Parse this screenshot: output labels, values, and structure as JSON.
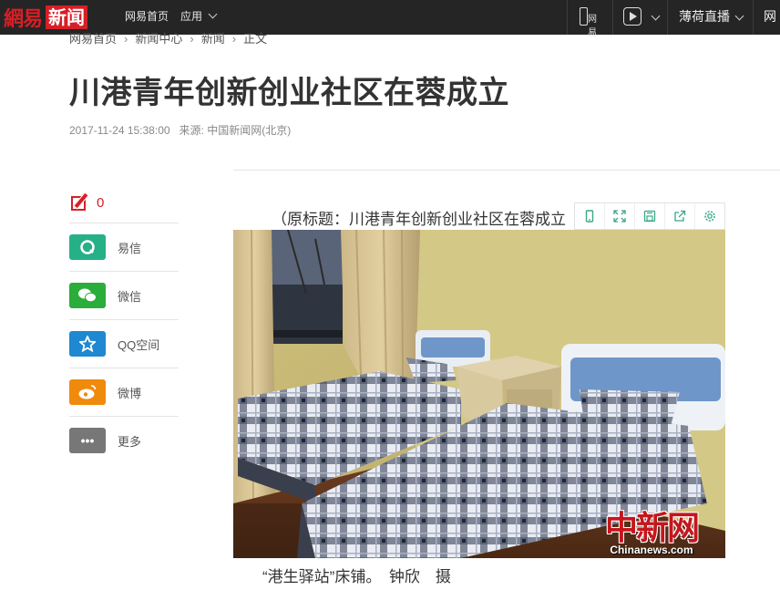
{
  "nav": {
    "logo_main": "網易",
    "logo_sub": "新闻",
    "home_link": "网易首页",
    "apps_link": "应用",
    "phone_label": "网易",
    "live_link": "薄荷直播",
    "more_link": "网"
  },
  "breadcrumb": [
    "网易首页",
    "新闻中心",
    "新闻",
    "正文"
  ],
  "article": {
    "title": "川港青年创新创业社区在蓉成立",
    "date": "2017-11-24 15:38:00",
    "source": "来源: 中国新闻网(北京)",
    "caption_top": "（原标题：川港青年创新创业社区在蓉成立",
    "caption_bottom": "“港生驿站”床铺。　钟欣　摄"
  },
  "sidebar": {
    "comment_count": "0",
    "share": [
      {
        "label": "易信",
        "icon": "yixin-icon",
        "color": "#26b087"
      },
      {
        "label": "微信",
        "icon": "wechat-icon",
        "color": "#2bad3b"
      },
      {
        "label": "QQ空间",
        "icon": "qzone-icon",
        "color": "#1e88d0"
      },
      {
        "label": "微博",
        "icon": "weibo-icon",
        "color": "#ef8a0c"
      },
      {
        "label": "更多",
        "icon": "more-icon",
        "color": "#777777"
      }
    ]
  },
  "image": {
    "watermark_cn": "中新网",
    "watermark_en": "Chinanews.com"
  },
  "toolbar": [
    "phone-icon",
    "fullscreen-icon",
    "save-icon",
    "share-icon",
    "settings-icon"
  ]
}
